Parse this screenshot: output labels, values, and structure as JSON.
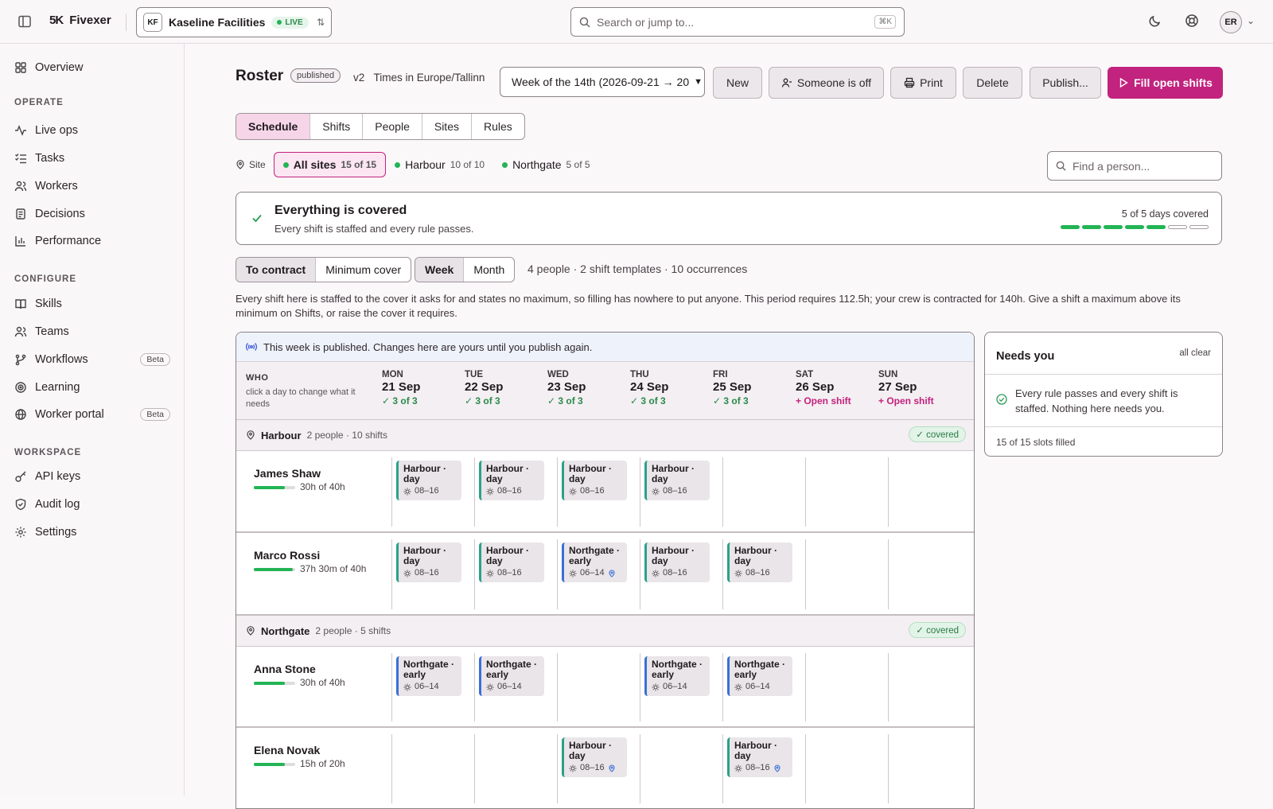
{
  "topbar": {
    "brand": "Fivexer",
    "org_initials": "KF",
    "org_name": "Kaseline Facilities",
    "live_label": "LIVE",
    "search_placeholder": "Search or jump to...",
    "search_shortcut": "⌘K",
    "user_initials": "ER"
  },
  "sidebar": {
    "overview": "Overview",
    "operate_heading": "OPERATE",
    "operate": [
      "Live ops",
      "Tasks",
      "Workers",
      "Decisions",
      "Performance"
    ],
    "configure_heading": "CONFIGURE",
    "configure": [
      "Skills",
      "Teams",
      "Workflows",
      "Learning",
      "Worker portal"
    ],
    "beta_label": "Beta",
    "workspace_heading": "WORKSPACE",
    "workspace": [
      "API keys",
      "Audit log",
      "Settings"
    ]
  },
  "header": {
    "title": "Roster",
    "status": "published",
    "version": "v2",
    "timezone": "Times in Europe/Tallinn",
    "week_select": "Week of the 14th (2026-09-21 → 20",
    "buttons": {
      "new": "New",
      "someone_off": "Someone is off",
      "print": "Print",
      "delete": "Delete",
      "publish": "Publish...",
      "fill": "Fill open shifts"
    }
  },
  "tabs": [
    "Schedule",
    "Shifts",
    "People",
    "Sites",
    "Rules"
  ],
  "sites": {
    "label": "Site",
    "items": [
      {
        "name": "All sites",
        "count": "15 of 15"
      },
      {
        "name": "Harbour",
        "count": "10 of 10"
      },
      {
        "name": "Northgate",
        "count": "5 of 5"
      }
    ],
    "find_placeholder": "Find a person..."
  },
  "coverage": {
    "title": "Everything is covered",
    "subtitle": "Every shift is staffed and every rule passes.",
    "days_covered": "5 of 5 days covered",
    "days_filled": 5,
    "days_total": 7
  },
  "view": {
    "mode": [
      "To contract",
      "Minimum cover"
    ],
    "period": [
      "Week",
      "Month"
    ],
    "summary": "4 people · 2 shift templates · 10 occurrences",
    "note": "Every shift here is staffed to the cover it asks for and states no maximum, so filling has nowhere to put anyone. This period requires 112.5h; your crew is contracted for 140h. Give a shift a maximum above its minimum on Shifts, or raise the cover it requires."
  },
  "grid": {
    "banner": "This week is published. Changes here are yours until you publish again.",
    "who": "WHO",
    "who_sub": "click a day to change what it needs",
    "days": [
      {
        "dow": "MON",
        "date": "21 Sep",
        "status": "3 of 3",
        "open": false
      },
      {
        "dow": "TUE",
        "date": "22 Sep",
        "status": "3 of 3",
        "open": false
      },
      {
        "dow": "WED",
        "date": "23 Sep",
        "status": "3 of 3",
        "open": false
      },
      {
        "dow": "THU",
        "date": "24 Sep",
        "status": "3 of 3",
        "open": false
      },
      {
        "dow": "FRI",
        "date": "25 Sep",
        "status": "3 of 3",
        "open": false
      },
      {
        "dow": "SAT",
        "date": "26 Sep",
        "status": "Open shift",
        "open": true
      },
      {
        "dow": "SUN",
        "date": "27 Sep",
        "status": "Open shift",
        "open": true
      }
    ],
    "groups": [
      {
        "name": "Harbour",
        "meta": "2 people · 10 shifts",
        "badge": "covered"
      },
      {
        "name": "Northgate",
        "meta": "2 people · 5 shifts",
        "badge": "covered"
      }
    ],
    "people": [
      {
        "name": "James Shaw",
        "hours": "30h of 40h",
        "fill": 0.75,
        "shifts": [
          {
            "day": 0,
            "name": "Harbour · day",
            "time": "08–16",
            "kind": "day",
            "pin": false
          },
          {
            "day": 1,
            "name": "Harbour · day",
            "time": "08–16",
            "kind": "day",
            "pin": false
          },
          {
            "day": 2,
            "name": "Harbour · day",
            "time": "08–16",
            "kind": "day",
            "pin": false
          },
          {
            "day": 3,
            "name": "Harbour · day",
            "time": "08–16",
            "kind": "day",
            "pin": false
          }
        ]
      },
      {
        "name": "Marco Rossi",
        "hours": "37h 30m of 40h",
        "fill": 0.94,
        "shifts": [
          {
            "day": 0,
            "name": "Harbour · day",
            "time": "08–16",
            "kind": "day",
            "pin": false
          },
          {
            "day": 1,
            "name": "Harbour · day",
            "time": "08–16",
            "kind": "day",
            "pin": false
          },
          {
            "day": 2,
            "name": "Northgate · early",
            "time": "06–14",
            "kind": "early",
            "pin": true
          },
          {
            "day": 3,
            "name": "Harbour · day",
            "time": "08–16",
            "kind": "day",
            "pin": false
          },
          {
            "day": 4,
            "name": "Harbour · day",
            "time": "08–16",
            "kind": "day",
            "pin": false
          }
        ]
      },
      {
        "name": "Anna Stone",
        "hours": "30h of 40h",
        "fill": 0.75,
        "shifts": [
          {
            "day": 0,
            "name": "Northgate · early",
            "time": "06–14",
            "kind": "early",
            "pin": false
          },
          {
            "day": 1,
            "name": "Northgate · early",
            "time": "06–14",
            "kind": "early",
            "pin": false
          },
          {
            "day": 3,
            "name": "Northgate · early",
            "time": "06–14",
            "kind": "early",
            "pin": false
          },
          {
            "day": 4,
            "name": "Northgate · early",
            "time": "06–14",
            "kind": "early",
            "pin": false
          }
        ]
      },
      {
        "name": "Elena Novak",
        "hours": "15h of 20h",
        "fill": 0.75,
        "shifts": [
          {
            "day": 2,
            "name": "Harbour · day",
            "time": "08–16",
            "kind": "day",
            "pin": true
          },
          {
            "day": 4,
            "name": "Harbour · day",
            "time": "08–16",
            "kind": "day",
            "pin": true
          }
        ]
      }
    ]
  },
  "needs_you": {
    "title": "Needs you",
    "status": "all clear",
    "message": "Every rule passes and every shift is staffed. Nothing here needs you.",
    "footer": "15 of 15 slots filled"
  },
  "colors": {
    "accent": "#c2237e",
    "success": "#22b455",
    "shift_day": "#2aa18a",
    "shift_early": "#3b6fd6"
  }
}
